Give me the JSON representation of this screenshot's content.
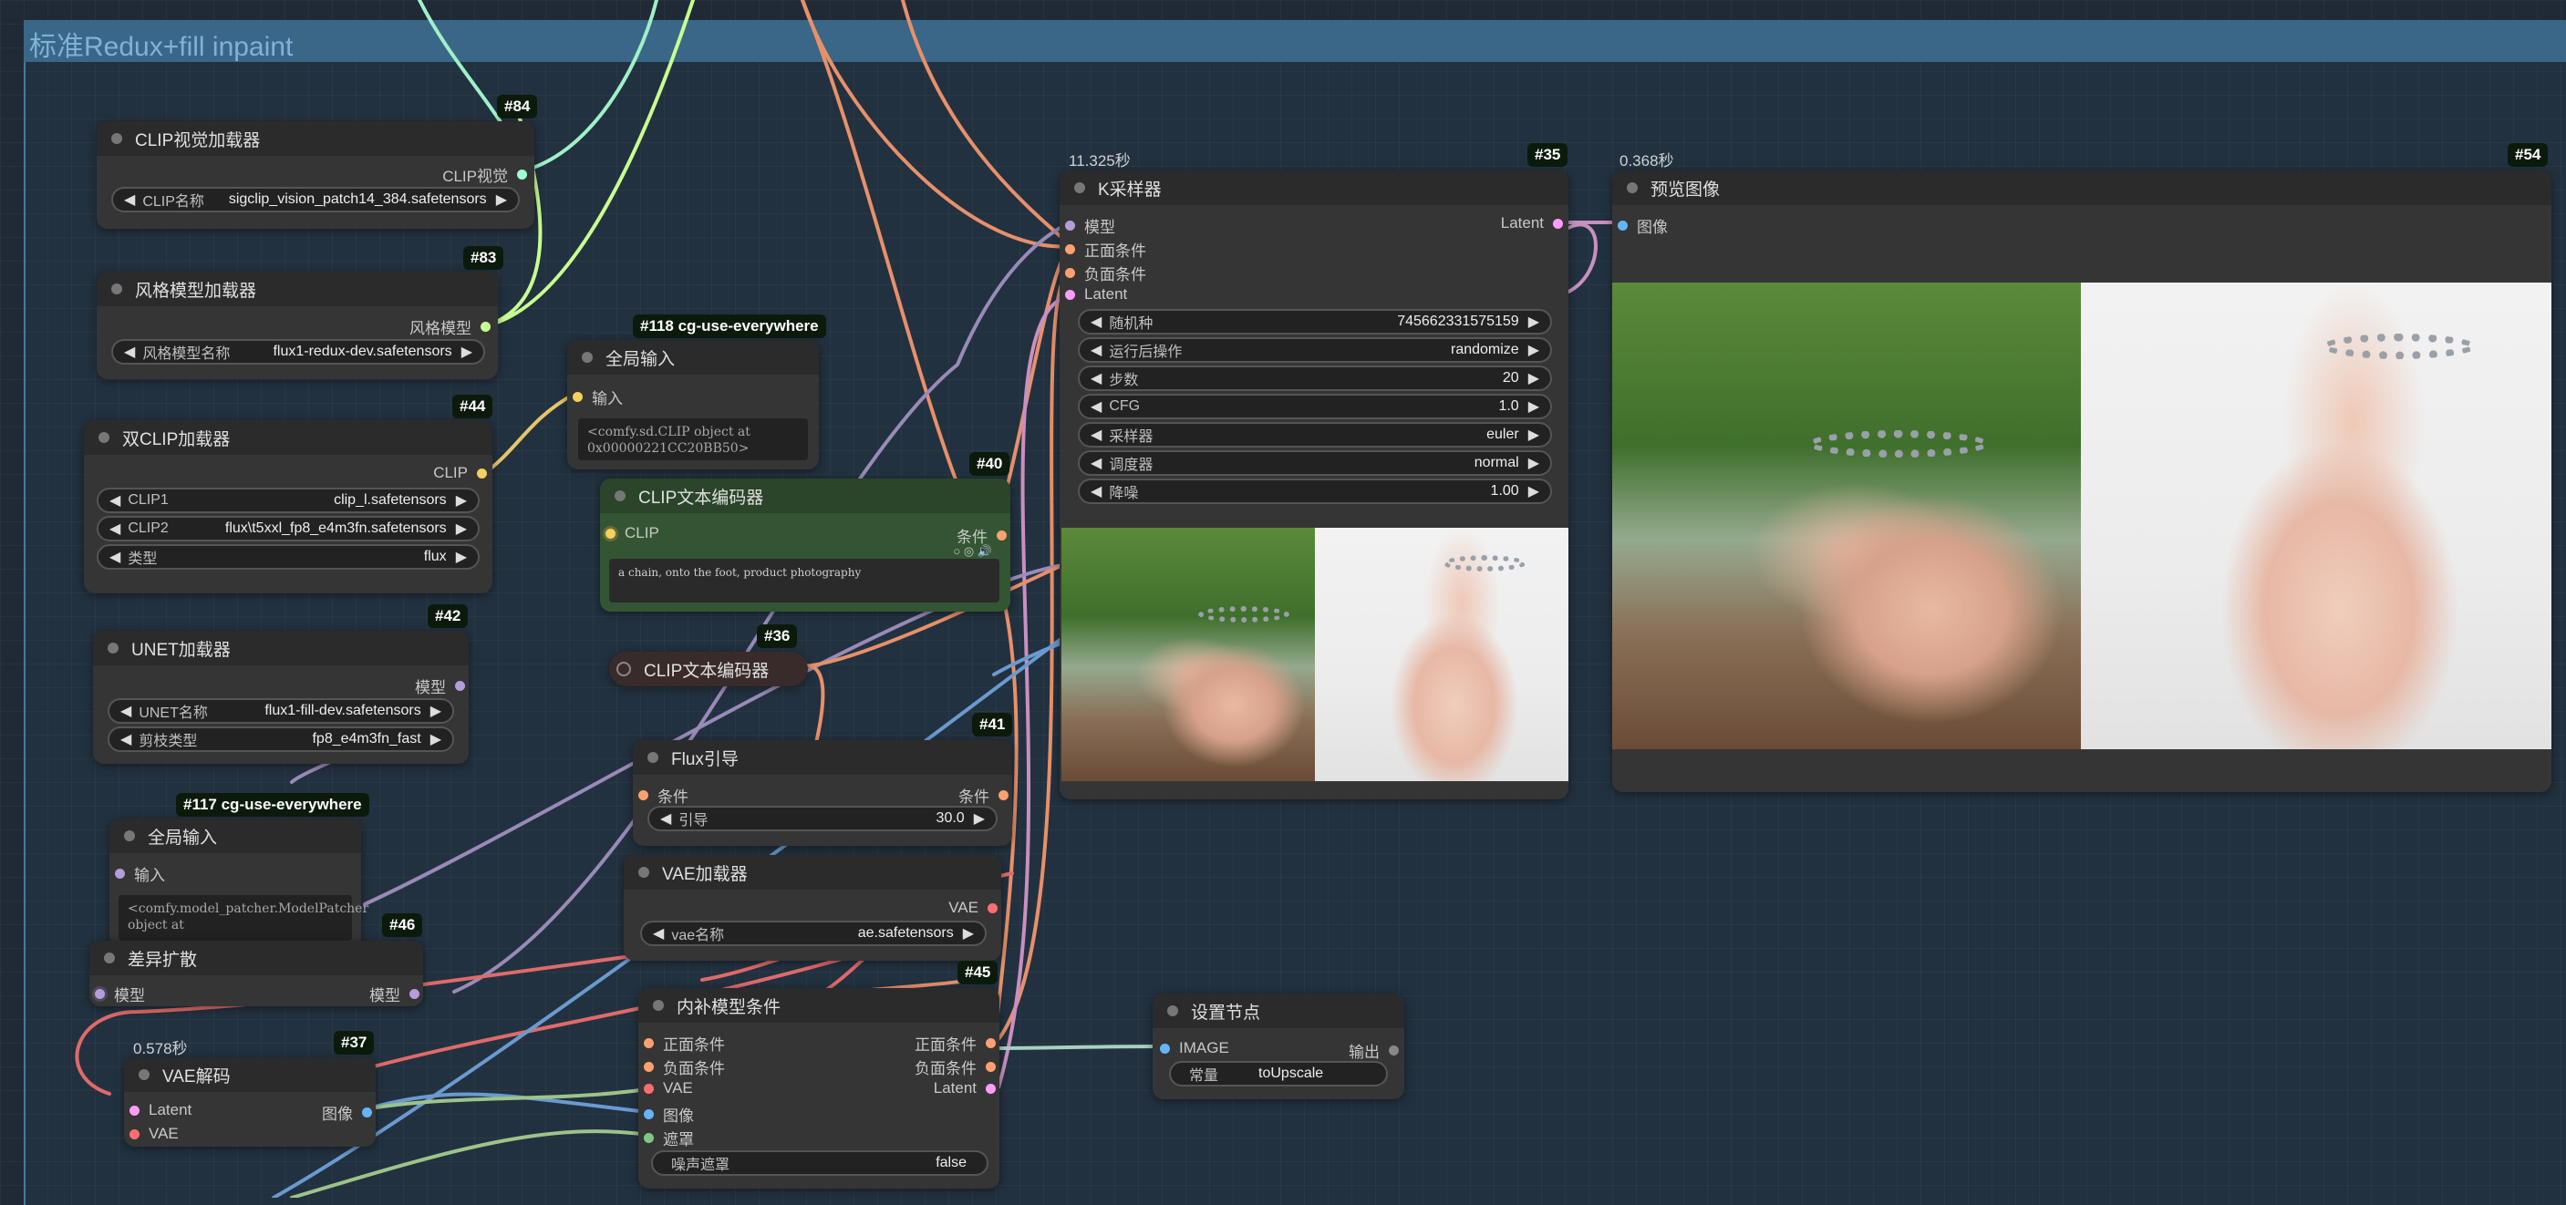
{
  "group": {
    "title": "标准Redux+fill inpaint"
  },
  "nodes": {
    "clip_vision_loader": {
      "title": "CLIP视觉加载器",
      "badge": "#84",
      "out": "CLIP视觉",
      "widget_label": "CLIP名称",
      "widget_value": "sigclip_vision_patch14_384.safetensors"
    },
    "style_model_loader": {
      "title": "风格模型加载器",
      "badge": "#83",
      "out": "风格模型",
      "widget_label": "风格模型名称",
      "widget_value": "flux1-redux-dev.safetensors"
    },
    "global_input_118": {
      "title": "全局输入",
      "badge": "#118 cg-use-everywhere",
      "in": "输入",
      "text": "<comfy.sd.CLIP object at 0x00000221CC20BB50>"
    },
    "dual_clip_loader": {
      "title": "双CLIP加载器",
      "badge": "#44",
      "out": "CLIP",
      "widgets": [
        {
          "label": "CLIP1",
          "value": "clip_l.safetensors"
        },
        {
          "label": "CLIP2",
          "value": "flux\\t5xxl_fp8_e4m3fn.safetensors"
        },
        {
          "label": "类型",
          "value": "flux"
        }
      ]
    },
    "clip_text_encoder_40": {
      "title": "CLIP文本编码器",
      "badge": "#40",
      "in": "CLIP",
      "out": "条件",
      "text": "a chain, onto the foot, product photography"
    },
    "clip_text_encoder_36": {
      "title": "CLIP文本编码器",
      "badge": "#36"
    },
    "unet_loader": {
      "title": "UNET加载器",
      "badge": "#42",
      "out": "模型",
      "widgets": [
        {
          "label": "UNET名称",
          "value": "flux1-fill-dev.safetensors"
        },
        {
          "label": "剪枝类型",
          "value": "fp8_e4m3fn_fast"
        }
      ]
    },
    "flux_guidance": {
      "title": "Flux引导",
      "badge": "#41",
      "in": "条件",
      "out": "条件",
      "widget_label": "引导",
      "widget_value": "30.0"
    },
    "global_input_117": {
      "title": "全局输入",
      "badge": "#117 cg-use-everywhere",
      "in": "输入",
      "text": "<comfy.model_patcher.ModelPatcher object at"
    },
    "diff_diffusion": {
      "title": "差异扩散",
      "badge": "#46",
      "in": "模型",
      "out": "模型"
    },
    "vae_loader": {
      "title": "VAE加载器",
      "out": "VAE",
      "widget_label": "vae名称",
      "widget_value": "ae.safetensors"
    },
    "inpaint_cond": {
      "title": "内补模型条件",
      "badge": "#45",
      "ins": [
        "正面条件",
        "负面条件",
        "VAE",
        "图像",
        "遮罩"
      ],
      "outs": [
        "正面条件",
        "负面条件",
        "Latent"
      ],
      "widget_label": "噪声遮罩",
      "widget_value": "false"
    },
    "vae_decode": {
      "title": "VAE解码",
      "badge": "#37",
      "timing": "0.578秒",
      "ins": [
        "Latent",
        "VAE"
      ],
      "out": "图像"
    },
    "ksampler": {
      "title": "K采样器",
      "badge": "#35",
      "timing": "11.325秒",
      "ins": [
        "模型",
        "正面条件",
        "负面条件",
        "Latent"
      ],
      "out": "Latent",
      "widgets": [
        {
          "label": "随机种",
          "value": "745662331575159"
        },
        {
          "label": "运行后操作",
          "value": "randomize"
        },
        {
          "label": "步数",
          "value": "20"
        },
        {
          "label": "CFG",
          "value": "1.0"
        },
        {
          "label": "采样器",
          "value": "euler"
        },
        {
          "label": "调度器",
          "value": "normal"
        },
        {
          "label": "降噪",
          "value": "1.00"
        }
      ]
    },
    "preview_image": {
      "title": "预览图像",
      "badge": "#54",
      "timing": "0.368秒",
      "in": "图像"
    },
    "set_node": {
      "title": "设置节点",
      "in": "IMAGE",
      "out": "输出",
      "widget_label": "常量",
      "widget_value": "toUpscale"
    }
  },
  "colors": {
    "clip": "#f2d15c",
    "model": "#b39ddb",
    "cond": "#ffa070",
    "latent": "#ff9cf9",
    "vae": "#ff6e6e",
    "image": "#64b5f6",
    "mask": "#81c784",
    "clip_vision": "#a0ffd0",
    "style": "#c8ff90"
  }
}
